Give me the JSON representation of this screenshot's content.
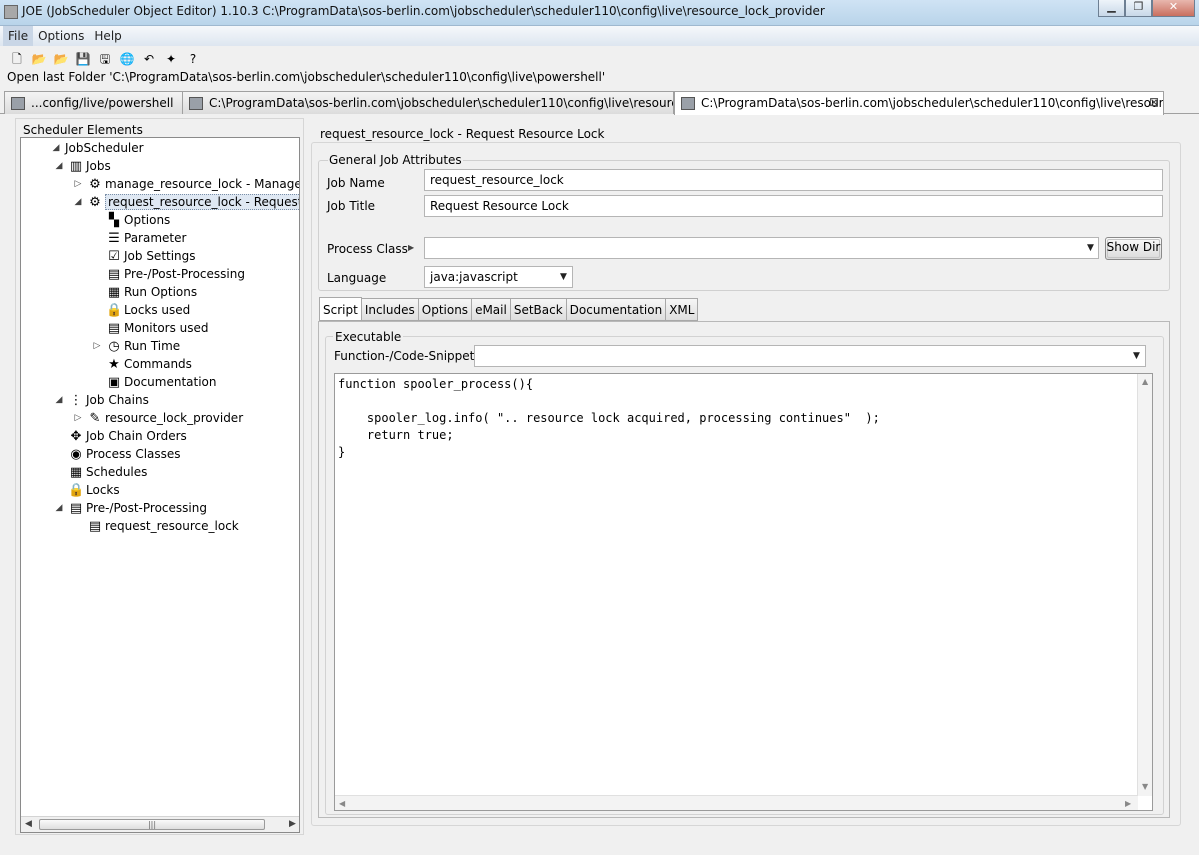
{
  "window": {
    "title": "JOE (JobScheduler Object Editor) 1.10.3 C:\\ProgramData\\sos-berlin.com\\jobscheduler\\scheduler110\\config\\live\\resource_lock_provider",
    "buttons": {
      "minimize": "▁",
      "maximize": "❐",
      "close": "✕"
    }
  },
  "menu": [
    "File",
    "Options",
    "Help"
  ],
  "toolbar": [
    {
      "icon": "new-file-icon",
      "glyph": "🗋"
    },
    {
      "icon": "open-folder-icon",
      "glyph": "📂"
    },
    {
      "icon": "open-live-folder-icon",
      "glyph": "📂"
    },
    {
      "icon": "save-icon",
      "glyph": "💾"
    },
    {
      "icon": "save-as-icon",
      "glyph": "🖫"
    },
    {
      "icon": "web-service-icon",
      "glyph": "🌐"
    },
    {
      "icon": "undo-icon",
      "glyph": "↶"
    },
    {
      "icon": "wizard-icon",
      "glyph": "✦"
    },
    {
      "icon": "help-icon",
      "glyph": "?"
    }
  ],
  "last_folder": "Open last Folder 'C:\\ProgramData\\sos-berlin.com\\jobscheduler\\scheduler110\\config\\live\\powershell'",
  "file_tabs": [
    {
      "label": "...config/live/powershell",
      "active": false
    },
    {
      "label": "C:\\ProgramData\\sos-berlin.com\\jobscheduler\\scheduler110\\config\\live\\resource_l",
      "active": false
    },
    {
      "label": "C:\\ProgramData\\sos-berlin.com\\jobscheduler\\scheduler110\\config\\live\\resource_l",
      "active": true,
      "close": "⊠"
    }
  ],
  "tree": {
    "title": "Scheduler Elements",
    "items": [
      {
        "label": "JobScheduler",
        "level": 0,
        "twisty": "◢",
        "icon": "",
        "icon_name": "none"
      },
      {
        "label": "Jobs",
        "level": 1,
        "twisty": "◢",
        "icon": "▥",
        "icon_name": "jobs-icon"
      },
      {
        "label": "manage_resource_lock - Manage access to resource",
        "level": 2,
        "twisty": "▷",
        "icon": "⚙",
        "icon_name": "job-icon"
      },
      {
        "label": "request_resource_lock - Request Resource Lock",
        "level": 2,
        "twisty": "◢",
        "icon": "⚙",
        "icon_name": "job-icon",
        "selected": true
      },
      {
        "label": "Options",
        "level": 3,
        "twisty": "",
        "icon": "▚",
        "icon_name": "options-icon"
      },
      {
        "label": "Parameter",
        "level": 3,
        "twisty": "",
        "icon": "☰",
        "icon_name": "parameter-icon"
      },
      {
        "label": "Job Settings",
        "level": 3,
        "twisty": "",
        "icon": "☑",
        "icon_name": "job-settings-icon"
      },
      {
        "label": "Pre-/Post-Processing",
        "level": 3,
        "twisty": "",
        "icon": "▤",
        "icon_name": "pre-post-processing-icon"
      },
      {
        "label": "Run Options",
        "level": 3,
        "twisty": "",
        "icon": "▦",
        "icon_name": "run-options-icon"
      },
      {
        "label": "Locks used",
        "level": 3,
        "twisty": "",
        "icon": "🔒",
        "icon_name": "lock-icon"
      },
      {
        "label": "Monitors used",
        "level": 3,
        "twisty": "",
        "icon": "▤",
        "icon_name": "monitor-icon"
      },
      {
        "label": "Run Time",
        "level": 3,
        "twisty": "▷",
        "icon": "◷",
        "icon_name": "clock-icon"
      },
      {
        "label": "Commands",
        "level": 3,
        "twisty": "",
        "icon": "★",
        "icon_name": "star-icon"
      },
      {
        "label": "Documentation",
        "level": 3,
        "twisty": "",
        "icon": "▣",
        "icon_name": "documentation-icon"
      },
      {
        "label": "Job Chains",
        "level": 1,
        "twisty": "◢",
        "icon": "⋮",
        "icon_name": "job-chains-icon"
      },
      {
        "label": "resource_lock_provider",
        "level": 2,
        "twisty": "▷",
        "icon": "✎",
        "icon_name": "job-chain-icon"
      },
      {
        "label": "Job Chain Orders",
        "level": 1,
        "twisty": "",
        "icon": "✥",
        "icon_name": "orders-icon"
      },
      {
        "label": "Process Classes",
        "level": 1,
        "twisty": "",
        "icon": "◉",
        "icon_name": "process-class-icon"
      },
      {
        "label": "Schedules",
        "level": 1,
        "twisty": "",
        "icon": "▦",
        "icon_name": "schedule-icon"
      },
      {
        "label": "Locks",
        "level": 1,
        "twisty": "",
        "icon": "🔒",
        "icon_name": "lock-icon"
      },
      {
        "label": "Pre-/Post-Processing",
        "level": 1,
        "twisty": "◢",
        "icon": "▤",
        "icon_name": "pre-post-processing-icon"
      },
      {
        "label": "request_resource_lock",
        "level": 2,
        "twisty": "",
        "icon": "▤",
        "icon_name": "monitor-icon"
      }
    ],
    "hscroll_arrows": [
      "◀",
      "▶"
    ],
    "hscroll_grip": "|||"
  },
  "job": {
    "header": "request_resource_lock - Request Resource Lock",
    "group_title": "General Job Attributes",
    "name_label": "Job Name",
    "name_value": "request_resource_lock",
    "title_label": "Job Title",
    "title_value": "Request Resource Lock",
    "process_class_label": "Process Class",
    "process_class_value": "",
    "process_class_arrow": "▶",
    "show_dir_button": "Show Dir",
    "language_label": "Language",
    "language_value": "java:javascript"
  },
  "sub_tabs": [
    {
      "label": "Script",
      "active": true
    },
    {
      "label": "Includes"
    },
    {
      "label": "Options"
    },
    {
      "label": "eMail"
    },
    {
      "label": "SetBack"
    },
    {
      "label": "Documentation"
    },
    {
      "label": "XML"
    }
  ],
  "script": {
    "group_title": "Executable",
    "snippets_label": "Function-/Code-Snippets",
    "snippets_value": "",
    "code": "function spooler_process(){\n\n    spooler_log.info( \".. resource lock acquired, processing continues\"  );\n    return true;\n}"
  },
  "combo_arrow": "▼"
}
